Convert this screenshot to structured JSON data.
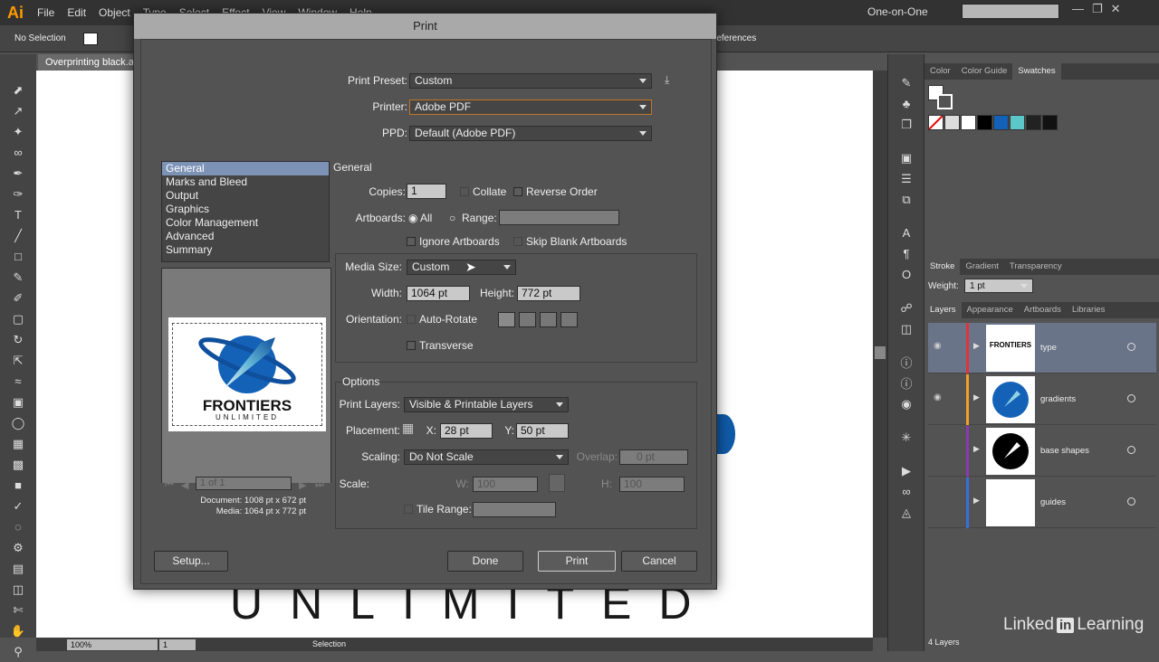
{
  "menubar": {
    "logo": "Ai",
    "menus": [
      "File",
      "Edit",
      "Object",
      "Type",
      "Select",
      "Effect",
      "View",
      "Window",
      "Help"
    ],
    "workspace": "One-on-One"
  },
  "control_bar": {
    "selection": "No Selection",
    "preferences_label": "references"
  },
  "document": {
    "tab_title": "Overprinting black.ai",
    "artboard_text": "UNLIMITED"
  },
  "status_bar": {
    "zoom": "100%",
    "page": "1",
    "tool": "Selection"
  },
  "right_panels": {
    "swatch_tabs": [
      "Color",
      "Color Guide",
      "Swatches"
    ],
    "stroke_tabs": [
      "Stroke",
      "Gradient",
      "Transparency"
    ],
    "weight_label": "Weight:",
    "weight_value": "1 pt",
    "layer_tabs": [
      "Layers",
      "Appearance",
      "Artboards",
      "Libraries"
    ],
    "layers": [
      {
        "name": "type",
        "color": "#e0343c"
      },
      {
        "name": "gradients",
        "color": "#f0a028"
      },
      {
        "name": "base shapes",
        "color": "#8a3ab0"
      },
      {
        "name": "guides",
        "color": "#3a6fd8"
      }
    ],
    "layers_count": "4 Layers"
  },
  "watermark": {
    "brand_a": "Linked",
    "brand_in": "in",
    "brand_b": "Learning"
  },
  "print_dialog": {
    "title": "Print",
    "print_preset_label": "Print Preset:",
    "print_preset": "Custom",
    "printer_label": "Printer:",
    "printer": "Adobe PDF",
    "ppd_label": "PPD:",
    "ppd": "Default (Adobe PDF)",
    "categories": [
      "General",
      "Marks and Bleed",
      "Output",
      "Graphics",
      "Color Management",
      "Advanced",
      "Summary"
    ],
    "selected_category": "General",
    "preview_logo_line1": "FRONTIERS",
    "preview_logo_line2": "UNLIMITED",
    "preview_page_nav": "1 of 1",
    "document_size": "Document: 1008 pt x 672 pt",
    "media_size_info": "Media: 1064 pt x 772 pt",
    "general_heading": "General",
    "copies_label": "Copies:",
    "copies": "1",
    "collate_label": "Collate",
    "reverse_order_label": "Reverse Order",
    "artboards_label": "Artboards:",
    "all_label": "All",
    "range_label": "Range:",
    "ignore_artboards_label": "Ignore Artboards",
    "skip_blank_label": "Skip Blank Artboards",
    "media_size_label": "Media Size:",
    "media_size": "Custom",
    "width_label": "Width:",
    "width": "1064 pt",
    "height_label": "Height:",
    "height": "772 pt",
    "orientation_label": "Orientation:",
    "auto_rotate_label": "Auto-Rotate",
    "transverse_label": "Transverse",
    "options_heading": "Options",
    "print_layers_label": "Print Layers:",
    "print_layers": "Visible & Printable Layers",
    "placement_label": "Placement:",
    "x_label": "X:",
    "x_value": "28 pt",
    "y_label": "Y:",
    "y_value": "50 pt",
    "scaling_label": "Scaling:",
    "scaling": "Do Not Scale",
    "overlap_label": "Overlap:",
    "overlap_value": "0 pt",
    "scale_label": "Scale:",
    "w_label": "W:",
    "w_value": "100",
    "h_label": "H:",
    "h_value": "100",
    "tile_range_label": "Tile Range:",
    "setup_button": "Setup...",
    "done_button": "Done",
    "print_button": "Print",
    "cancel_button": "Cancel"
  }
}
